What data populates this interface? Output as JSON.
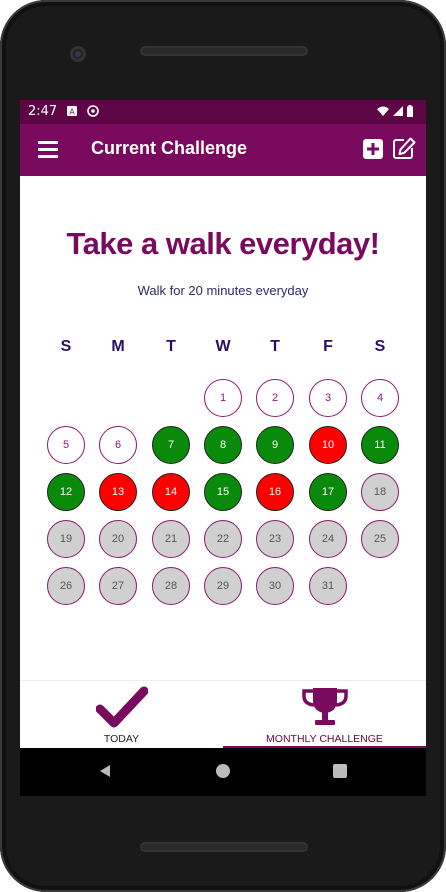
{
  "status": {
    "time": "2:47"
  },
  "appbar": {
    "title": "Current Challenge"
  },
  "challenge": {
    "title": "Take a walk everyday!",
    "subtitle": "Walk for 20 minutes everyday"
  },
  "weekdays": [
    "S",
    "M",
    "T",
    "W",
    "T",
    "F",
    "S"
  ],
  "calendar": {
    "first_weekday_index": 3,
    "days": [
      {
        "n": "1",
        "state": "future"
      },
      {
        "n": "2",
        "state": "future"
      },
      {
        "n": "3",
        "state": "future"
      },
      {
        "n": "4",
        "state": "future"
      },
      {
        "n": "5",
        "state": "future"
      },
      {
        "n": "6",
        "state": "future"
      },
      {
        "n": "7",
        "state": "done"
      },
      {
        "n": "8",
        "state": "done"
      },
      {
        "n": "9",
        "state": "done"
      },
      {
        "n": "10",
        "state": "missed"
      },
      {
        "n": "11",
        "state": "done"
      },
      {
        "n": "12",
        "state": "done"
      },
      {
        "n": "13",
        "state": "missed"
      },
      {
        "n": "14",
        "state": "missed"
      },
      {
        "n": "15",
        "state": "done"
      },
      {
        "n": "16",
        "state": "missed"
      },
      {
        "n": "17",
        "state": "done"
      },
      {
        "n": "18",
        "state": "past"
      },
      {
        "n": "19",
        "state": "past"
      },
      {
        "n": "20",
        "state": "past"
      },
      {
        "n": "21",
        "state": "past"
      },
      {
        "n": "22",
        "state": "past"
      },
      {
        "n": "23",
        "state": "past"
      },
      {
        "n": "24",
        "state": "past"
      },
      {
        "n": "25",
        "state": "past"
      },
      {
        "n": "26",
        "state": "past"
      },
      {
        "n": "27",
        "state": "past"
      },
      {
        "n": "28",
        "state": "past"
      },
      {
        "n": "29",
        "state": "past"
      },
      {
        "n": "30",
        "state": "past"
      },
      {
        "n": "31",
        "state": "past"
      }
    ]
  },
  "bottom_nav": {
    "today_label": "TODAY",
    "monthly_label": "MONTHLY CHALLENGE",
    "active": "monthly"
  },
  "colors": {
    "primary": "#7a0a5e",
    "status_bar": "#5e0545",
    "done": "#0a8a0a",
    "missed": "#ff0000",
    "past": "#d0d0d0"
  },
  "icons": {
    "menu": "menu-icon",
    "add": "add-icon",
    "edit": "edit-icon",
    "today": "checkmark-icon",
    "monthly": "trophy-icon"
  }
}
